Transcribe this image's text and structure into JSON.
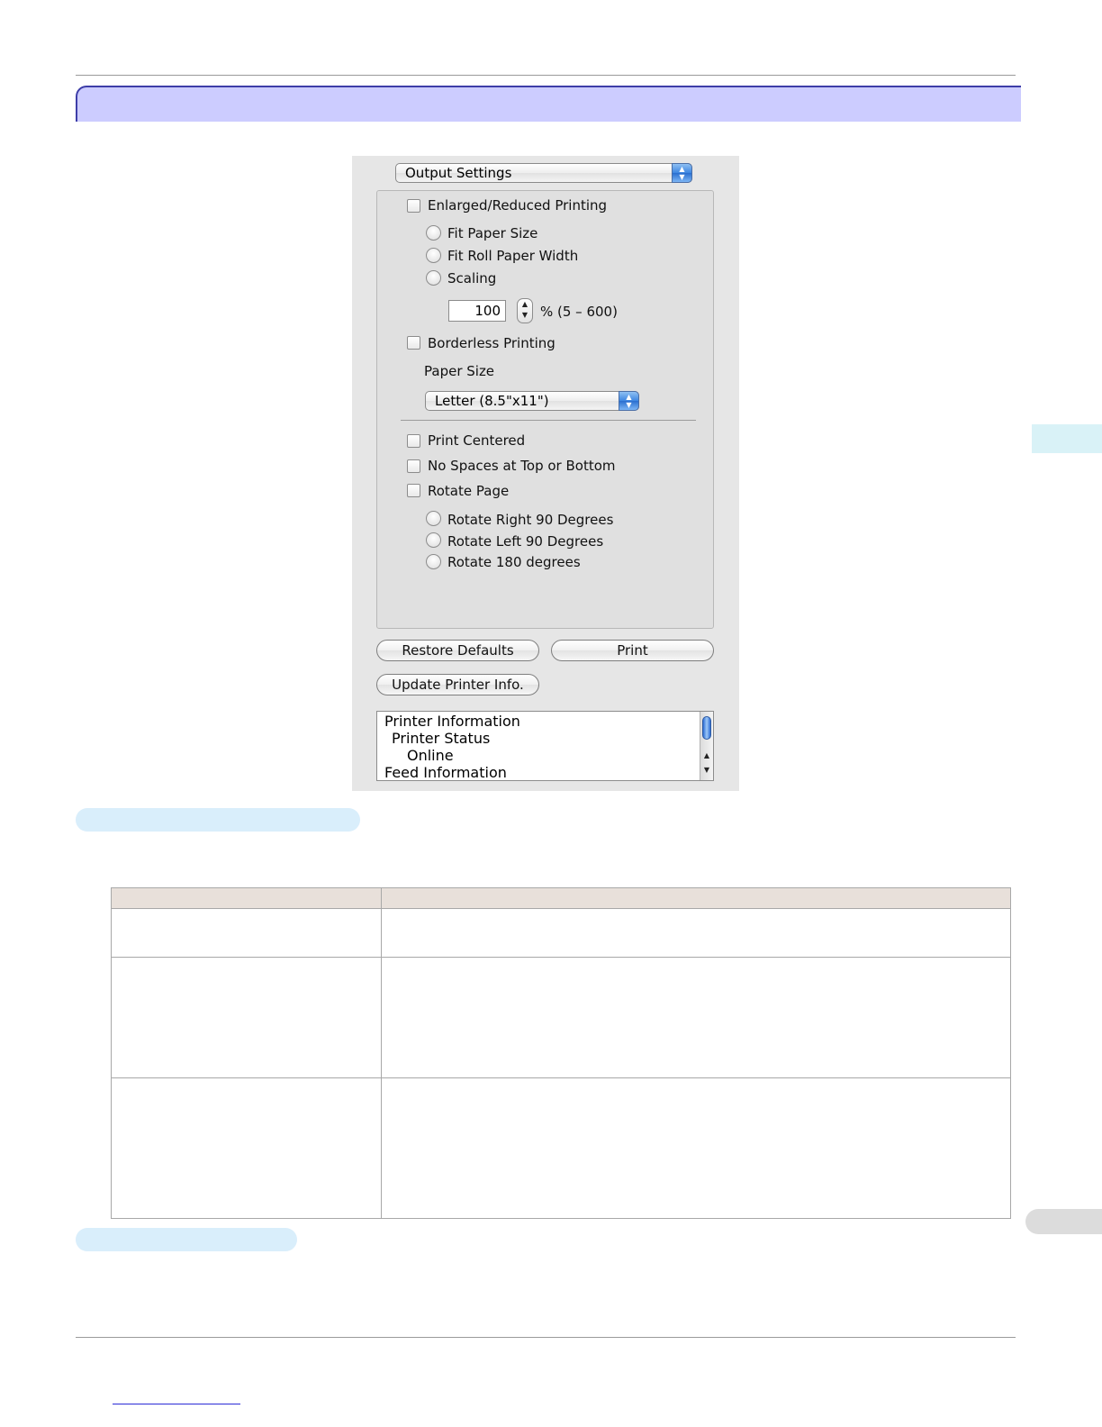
{
  "dialog": {
    "panel_select": "Output Settings",
    "enlarged_reduced": {
      "label": "Enlarged/Reduced Printing",
      "checked": false
    },
    "scale_options": [
      {
        "label": "Fit Paper Size",
        "selected": false
      },
      {
        "label": "Fit Roll Paper Width",
        "selected": false
      },
      {
        "label": "Scaling",
        "selected": false
      }
    ],
    "scaling_value": "100",
    "scaling_range": "% (5 – 600)",
    "borderless": {
      "label": "Borderless Printing",
      "checked": false
    },
    "paper_size_label": "Paper Size",
    "paper_size_value": "Letter (8.5\"x11\")",
    "print_centered": {
      "label": "Print Centered",
      "checked": false
    },
    "no_spaces": {
      "label": "No Spaces at Top or Bottom",
      "checked": false
    },
    "rotate_page": {
      "label": "Rotate Page",
      "checked": false
    },
    "rotate_options": [
      {
        "label": "Rotate Right 90 Degrees",
        "selected": false
      },
      {
        "label": "Rotate Left 90 Degrees",
        "selected": false
      },
      {
        "label": "Rotate 180 degrees",
        "selected": false
      }
    ],
    "buttons": {
      "restore": "Restore Defaults",
      "print": "Print",
      "update": "Update Printer Info."
    },
    "info_list": [
      "Printer Information",
      "Printer Status",
      "Online",
      "Feed Information"
    ]
  },
  "colors": {
    "title_band": "#ccccff",
    "title_border": "#3d3da8",
    "section_pill": "#d9eefb",
    "side_tab": "#d9f2f7",
    "table_header": "#e8e0da"
  }
}
